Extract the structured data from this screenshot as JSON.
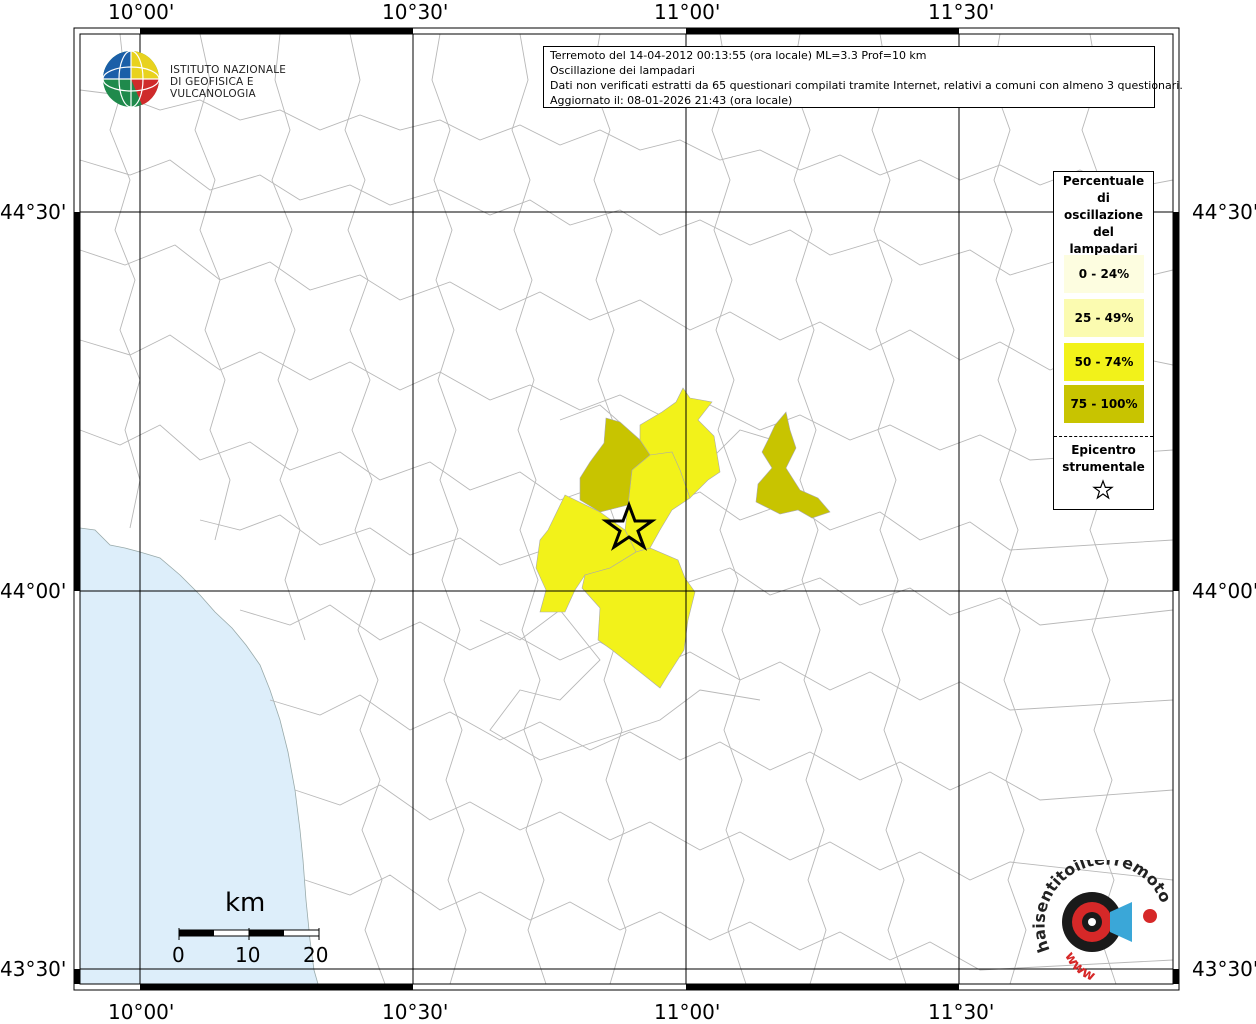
{
  "info": {
    "line1": "Terremoto del 14-04-2012 00:13:55 (ora locale) ML=3.3 Prof=10 km",
    "line2": "Oscillazione dei lampadari",
    "line3": "Dati non verificati estratti da 65 questionari compilati tramite Internet, relativi a comuni con almeno 3 questionari.",
    "line4": "Aggiornato il: 08-01-2026 21:43 (ora locale)"
  },
  "logo": {
    "line1": "ISTITUTO NAZIONALE",
    "line2": "DI GEOFISICA E VULCANOLOGIA"
  },
  "axes": {
    "top": [
      "10°00'",
      "10°30'",
      "11°00'",
      "11°30'"
    ],
    "bottom": [
      "10°00'",
      "10°30'",
      "11°00'",
      "11°30'"
    ],
    "left": [
      "44°30'",
      "44°00'",
      "43°30'"
    ],
    "right": [
      "44°30'",
      "44°00'",
      "43°30'"
    ]
  },
  "legend": {
    "title_lines": [
      "Percentuale",
      "di",
      "oscillazione",
      "del",
      "lampadari"
    ],
    "items": [
      {
        "label": "0 - 24%",
        "color": "#fdfde0"
      },
      {
        "label": "25 - 49%",
        "color": "#fbfbb0"
      },
      {
        "label": "50 - 74%",
        "color": "#f2f21a"
      },
      {
        "label": "75 - 100%",
        "color": "#c8c400"
      }
    ],
    "epicenter_lines": [
      "Epicentro",
      "strumentale"
    ]
  },
  "scale": {
    "unit": "km",
    "ticks": [
      "0",
      "10",
      "20"
    ]
  },
  "watermark": {
    "text_top": "haisentitoilterremoto.it",
    "text_bottom": "www"
  },
  "colors": {
    "sea": "#ddeefa",
    "yellow": "#f2f21a",
    "dark_yellow": "#c8c400",
    "borders": "#b8b8b8"
  }
}
